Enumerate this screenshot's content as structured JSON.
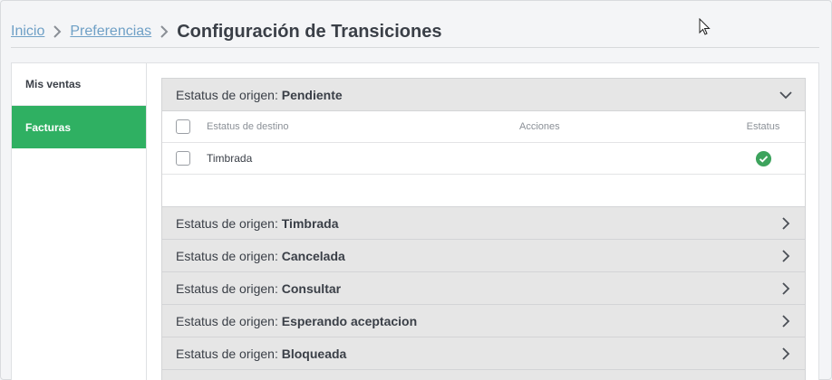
{
  "breadcrumb": {
    "items": [
      "Inicio",
      "Preferencias"
    ],
    "title": "Configuración de Transiciones"
  },
  "sidebar": {
    "items": [
      {
        "label": "Mis ventas",
        "active": false
      },
      {
        "label": "Facturas",
        "active": true
      }
    ]
  },
  "accordion": {
    "prefix": "Estatus de origen:",
    "open": {
      "name": "Pendiente",
      "table": {
        "headers": {
          "destino": "Estatus de destino",
          "acciones": "Acciones",
          "estatus": "Estatus"
        },
        "rows": [
          {
            "destino": "Timbrada",
            "acciones": "",
            "estatus": "active"
          }
        ]
      }
    },
    "collapsed": [
      "Timbrada",
      "Cancelada",
      "Consultar",
      "Esperando aceptacion",
      "Bloqueada"
    ]
  },
  "colors": {
    "accent": "#2fb062",
    "link": "#6fa0c6",
    "status_ok": "#3da35d"
  }
}
